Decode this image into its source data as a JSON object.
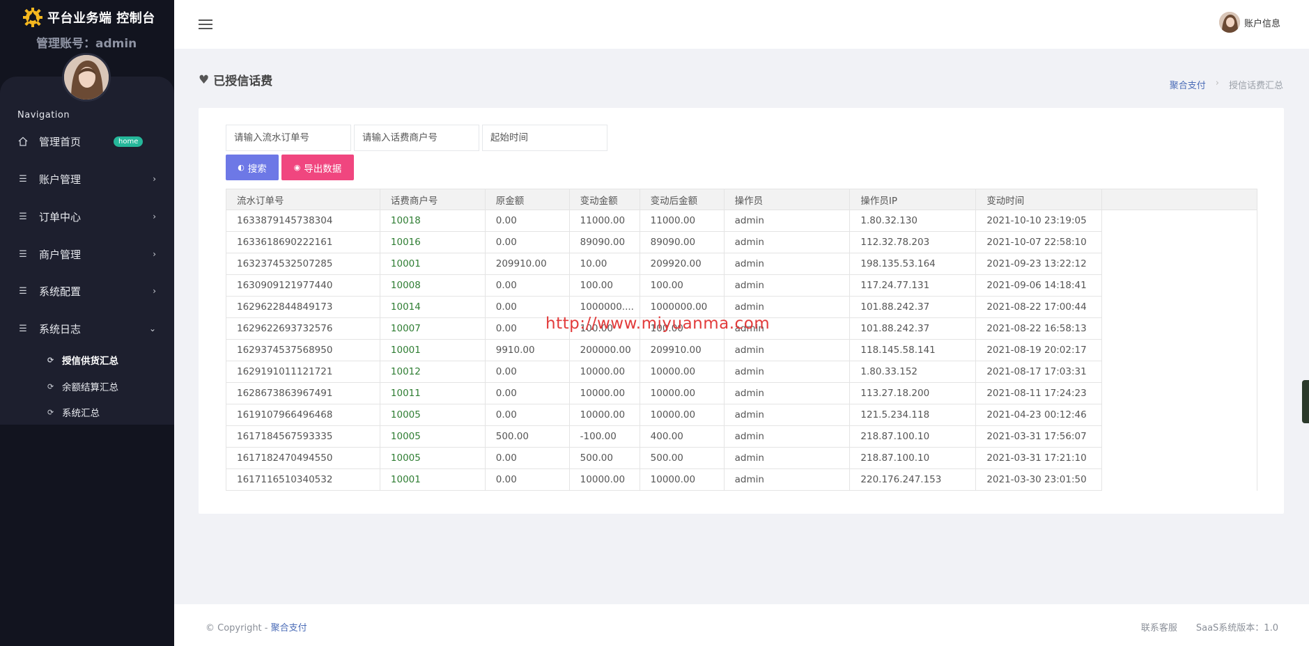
{
  "brand": {
    "title": "平台业务端 控制台"
  },
  "sidebar": {
    "admin_line": "管理账号：admin",
    "nav_caption": "Navigation",
    "items": [
      {
        "label": "管理首页",
        "icon": "home-icon",
        "badge": "home"
      },
      {
        "label": "账户管理",
        "icon": "list-icon"
      },
      {
        "label": "订单中心",
        "icon": "list-icon"
      },
      {
        "label": "商户管理",
        "icon": "list-icon"
      },
      {
        "label": "系统配置",
        "icon": "list-icon"
      },
      {
        "label": "系统日志",
        "icon": "list-icon",
        "expanded": true
      }
    ],
    "sub_items": [
      {
        "label": "授信供货汇总",
        "active": true
      },
      {
        "label": "余额结算汇总"
      },
      {
        "label": "系统汇总"
      }
    ]
  },
  "topbar": {
    "account_label": "账户信息"
  },
  "page": {
    "title": "已授信话费",
    "breadcrumb": {
      "home": "聚合支付",
      "current": "授信话费汇总"
    }
  },
  "filters": {
    "order_placeholder": "请输入流水订单号",
    "merchant_placeholder": "请输入话费商户号",
    "time_placeholder": "起始时间",
    "search_label": "搜索",
    "export_label": "导出数据"
  },
  "table": {
    "headers": [
      "流水订单号",
      "话费商户号",
      "原金额",
      "变动金额",
      "变动后金额",
      "操作员",
      "操作员IP",
      "变动时间"
    ],
    "rows": [
      [
        "1633879145738304",
        "10018",
        "0.00",
        "11000.00",
        "11000.00",
        "admin",
        "1.80.32.130",
        "2021-10-10 23:19:05"
      ],
      [
        "1633618690222161",
        "10016",
        "0.00",
        "89090.00",
        "89090.00",
        "admin",
        "112.32.78.203",
        "2021-10-07 22:58:10"
      ],
      [
        "1632374532507285",
        "10001",
        "209910.00",
        "10.00",
        "209920.00",
        "admin",
        "198.135.53.164",
        "2021-09-23 13:22:12"
      ],
      [
        "1630909121977440",
        "10008",
        "0.00",
        "100.00",
        "100.00",
        "admin",
        "117.24.77.131",
        "2021-09-06 14:18:41"
      ],
      [
        "1629622844849173",
        "10014",
        "0.00",
        "1000000....",
        "1000000.00",
        "admin",
        "101.88.242.37",
        "2021-08-22 17:00:44"
      ],
      [
        "1629622693732576",
        "10007",
        "0.00",
        "100.00",
        "100.00",
        "admin",
        "101.88.242.37",
        "2021-08-22 16:58:13"
      ],
      [
        "1629374537568950",
        "10001",
        "9910.00",
        "200000.00",
        "209910.00",
        "admin",
        "118.145.58.141",
        "2021-08-19 20:02:17"
      ],
      [
        "1629191011121721",
        "10012",
        "0.00",
        "10000.00",
        "10000.00",
        "admin",
        "1.80.33.152",
        "2021-08-17 17:03:31"
      ],
      [
        "1628673863967491",
        "10011",
        "0.00",
        "10000.00",
        "10000.00",
        "admin",
        "113.27.18.200",
        "2021-08-11 17:24:23"
      ],
      [
        "1619107966496468",
        "10005",
        "0.00",
        "10000.00",
        "10000.00",
        "admin",
        "121.5.234.118",
        "2021-04-23 00:12:46"
      ],
      [
        "1617184567593335",
        "10005",
        "500.00",
        "-100.00",
        "400.00",
        "admin",
        "218.87.100.10",
        "2021-03-31 17:56:07"
      ],
      [
        "1617182470494550",
        "10005",
        "0.00",
        "500.00",
        "500.00",
        "admin",
        "218.87.100.10",
        "2021-03-31 17:21:10"
      ],
      [
        "1617116510340532",
        "10001",
        "0.00",
        "10000.00",
        "10000.00",
        "admin",
        "220.176.247.153",
        "2021-03-30 23:01:50"
      ]
    ]
  },
  "watermark": "http://www.miyuanma.com",
  "footer": {
    "copyright_prefix": "© Copyright - ",
    "copyright_brand": "聚合支付",
    "support": "联系客服",
    "version": "SaaS系统版本：1.0"
  },
  "colors": {
    "sidebar_bg": "#12141f",
    "accent_blue": "#6d78e6",
    "accent_pink": "#f0467f",
    "merchant_green": "#2e7d32",
    "badge_green": "#25b79a"
  }
}
